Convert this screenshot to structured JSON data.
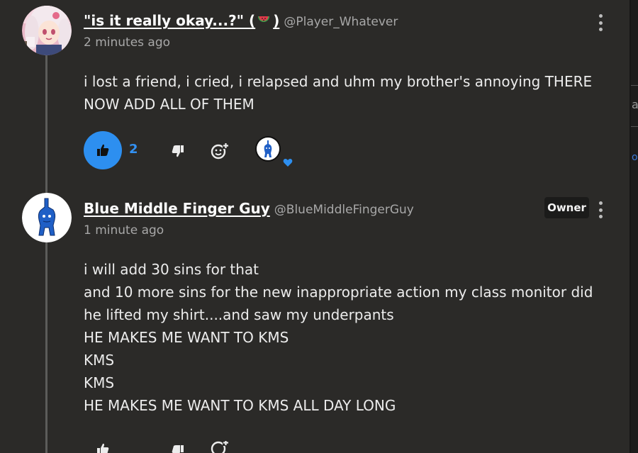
{
  "comments": [
    {
      "author": "\"is it really okay...?\" (",
      "emoji_suffix": ")",
      "handle": "@Player_Whatever",
      "time": "2 minutes ago",
      "body": [
        "i lost a friend, i cried, i relapsed and uhm my brother's annoying THERE",
        "NOW ADD ALL OF THEM"
      ],
      "likes": "2"
    },
    {
      "author": "Blue Middle Finger Guy",
      "handle": "@BlueMiddleFingerGuy",
      "badge": "Owner",
      "time": "1 minute ago",
      "body": [
        "i will add 30 sins for that",
        "and 10 more sins for the new inappropriate action my class monitor did",
        "he lifted my shirt....and saw my underpants",
        "HE MAKES ME WANT TO KMS",
        "KMS",
        "KMS",
        "HE MAKES ME WANT TO KMS ALL DAY LONG"
      ]
    }
  ],
  "side_panel": {
    "glyph_a": "a",
    "glyph_o": "o"
  },
  "icons": {
    "like": "thumbs-up-icon",
    "dislike": "thumbs-down-icon",
    "react": "add-emoji-icon",
    "menu": "more-vertical-icon",
    "heart": "heart-icon"
  },
  "colors": {
    "accent": "#2d8ff0",
    "background": "#2b2a28"
  }
}
